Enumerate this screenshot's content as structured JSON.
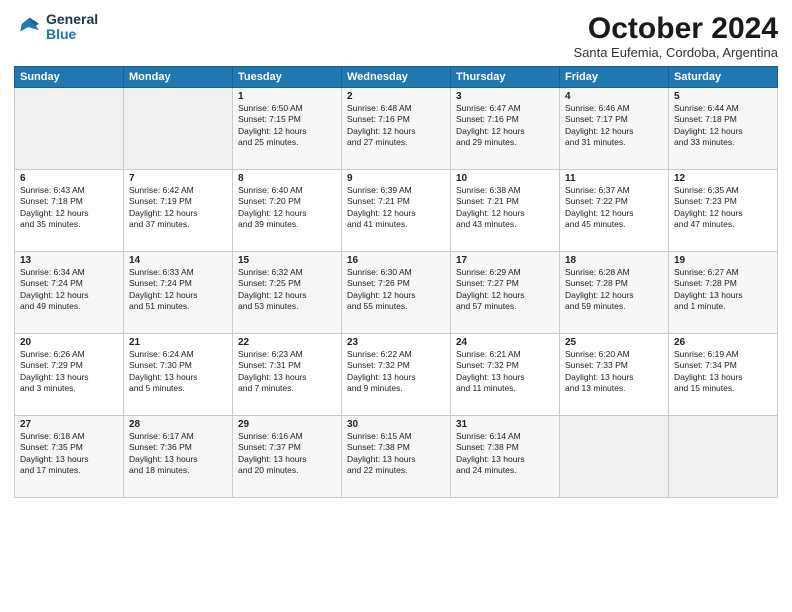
{
  "header": {
    "logo_line1": "General",
    "logo_line2": "Blue",
    "month": "October 2024",
    "location": "Santa Eufemia, Cordoba, Argentina"
  },
  "weekdays": [
    "Sunday",
    "Monday",
    "Tuesday",
    "Wednesday",
    "Thursday",
    "Friday",
    "Saturday"
  ],
  "weeks": [
    [
      {
        "day": "",
        "content": ""
      },
      {
        "day": "",
        "content": ""
      },
      {
        "day": "1",
        "content": "Sunrise: 6:50 AM\nSunset: 7:15 PM\nDaylight: 12 hours\nand 25 minutes."
      },
      {
        "day": "2",
        "content": "Sunrise: 6:48 AM\nSunset: 7:16 PM\nDaylight: 12 hours\nand 27 minutes."
      },
      {
        "day": "3",
        "content": "Sunrise: 6:47 AM\nSunset: 7:16 PM\nDaylight: 12 hours\nand 29 minutes."
      },
      {
        "day": "4",
        "content": "Sunrise: 6:46 AM\nSunset: 7:17 PM\nDaylight: 12 hours\nand 31 minutes."
      },
      {
        "day": "5",
        "content": "Sunrise: 6:44 AM\nSunset: 7:18 PM\nDaylight: 12 hours\nand 33 minutes."
      }
    ],
    [
      {
        "day": "6",
        "content": "Sunrise: 6:43 AM\nSunset: 7:18 PM\nDaylight: 12 hours\nand 35 minutes."
      },
      {
        "day": "7",
        "content": "Sunrise: 6:42 AM\nSunset: 7:19 PM\nDaylight: 12 hours\nand 37 minutes."
      },
      {
        "day": "8",
        "content": "Sunrise: 6:40 AM\nSunset: 7:20 PM\nDaylight: 12 hours\nand 39 minutes."
      },
      {
        "day": "9",
        "content": "Sunrise: 6:39 AM\nSunset: 7:21 PM\nDaylight: 12 hours\nand 41 minutes."
      },
      {
        "day": "10",
        "content": "Sunrise: 6:38 AM\nSunset: 7:21 PM\nDaylight: 12 hours\nand 43 minutes."
      },
      {
        "day": "11",
        "content": "Sunrise: 6:37 AM\nSunset: 7:22 PM\nDaylight: 12 hours\nand 45 minutes."
      },
      {
        "day": "12",
        "content": "Sunrise: 6:35 AM\nSunset: 7:23 PM\nDaylight: 12 hours\nand 47 minutes."
      }
    ],
    [
      {
        "day": "13",
        "content": "Sunrise: 6:34 AM\nSunset: 7:24 PM\nDaylight: 12 hours\nand 49 minutes."
      },
      {
        "day": "14",
        "content": "Sunrise: 6:33 AM\nSunset: 7:24 PM\nDaylight: 12 hours\nand 51 minutes."
      },
      {
        "day": "15",
        "content": "Sunrise: 6:32 AM\nSunset: 7:25 PM\nDaylight: 12 hours\nand 53 minutes."
      },
      {
        "day": "16",
        "content": "Sunrise: 6:30 AM\nSunset: 7:26 PM\nDaylight: 12 hours\nand 55 minutes."
      },
      {
        "day": "17",
        "content": "Sunrise: 6:29 AM\nSunset: 7:27 PM\nDaylight: 12 hours\nand 57 minutes."
      },
      {
        "day": "18",
        "content": "Sunrise: 6:28 AM\nSunset: 7:28 PM\nDaylight: 12 hours\nand 59 minutes."
      },
      {
        "day": "19",
        "content": "Sunrise: 6:27 AM\nSunset: 7:28 PM\nDaylight: 13 hours\nand 1 minute."
      }
    ],
    [
      {
        "day": "20",
        "content": "Sunrise: 6:26 AM\nSunset: 7:29 PM\nDaylight: 13 hours\nand 3 minutes."
      },
      {
        "day": "21",
        "content": "Sunrise: 6:24 AM\nSunset: 7:30 PM\nDaylight: 13 hours\nand 5 minutes."
      },
      {
        "day": "22",
        "content": "Sunrise: 6:23 AM\nSunset: 7:31 PM\nDaylight: 13 hours\nand 7 minutes."
      },
      {
        "day": "23",
        "content": "Sunrise: 6:22 AM\nSunset: 7:32 PM\nDaylight: 13 hours\nand 9 minutes."
      },
      {
        "day": "24",
        "content": "Sunrise: 6:21 AM\nSunset: 7:32 PM\nDaylight: 13 hours\nand 11 minutes."
      },
      {
        "day": "25",
        "content": "Sunrise: 6:20 AM\nSunset: 7:33 PM\nDaylight: 13 hours\nand 13 minutes."
      },
      {
        "day": "26",
        "content": "Sunrise: 6:19 AM\nSunset: 7:34 PM\nDaylight: 13 hours\nand 15 minutes."
      }
    ],
    [
      {
        "day": "27",
        "content": "Sunrise: 6:18 AM\nSunset: 7:35 PM\nDaylight: 13 hours\nand 17 minutes."
      },
      {
        "day": "28",
        "content": "Sunrise: 6:17 AM\nSunset: 7:36 PM\nDaylight: 13 hours\nand 18 minutes."
      },
      {
        "day": "29",
        "content": "Sunrise: 6:16 AM\nSunset: 7:37 PM\nDaylight: 13 hours\nand 20 minutes."
      },
      {
        "day": "30",
        "content": "Sunrise: 6:15 AM\nSunset: 7:38 PM\nDaylight: 13 hours\nand 22 minutes."
      },
      {
        "day": "31",
        "content": "Sunrise: 6:14 AM\nSunset: 7:38 PM\nDaylight: 13 hours\nand 24 minutes."
      },
      {
        "day": "",
        "content": ""
      },
      {
        "day": "",
        "content": ""
      }
    ]
  ]
}
